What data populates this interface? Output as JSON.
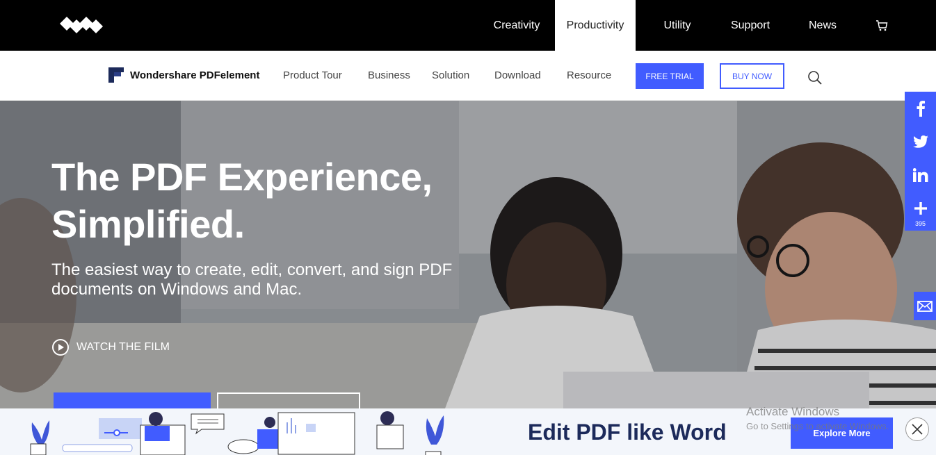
{
  "topbar": {
    "items": [
      {
        "label": "Creativity",
        "active": false
      },
      {
        "label": "Productivity",
        "active": true
      },
      {
        "label": "Utility",
        "active": false
      },
      {
        "label": "Support",
        "active": false
      },
      {
        "label": "News",
        "active": false
      }
    ],
    "logo_icon": "wondershare-logo",
    "cart_icon": "cart-icon"
  },
  "product_nav": {
    "brand": "Wondershare PDFelement",
    "links": [
      "Product Tour",
      "Business",
      "Solution",
      "Download",
      "Resource"
    ],
    "free_trial": "FREE TRIAL",
    "buy_now": "BUY NOW",
    "search_icon": "search-icon"
  },
  "hero": {
    "title_line1": "The PDF Experience,",
    "title_line2": "Simplified.",
    "subtitle": "The easiest way to create, edit, convert, and sign PDF documents on Windows and Mac.",
    "watch": "WATCH THE FILM"
  },
  "share": {
    "count": "395",
    "icons": [
      "facebook-icon",
      "twitter-icon",
      "linkedin-icon",
      "plus-icon",
      "mail-icon"
    ]
  },
  "banner": {
    "title": "Edit PDF like Word",
    "button": "Explore More"
  },
  "watermark": {
    "line1": "Activate Windows",
    "line2": "Go to Settings to activate Windows."
  },
  "colors": {
    "accent": "#415cff",
    "topbar": "#000000",
    "banner_title": "#1c2a5a"
  }
}
